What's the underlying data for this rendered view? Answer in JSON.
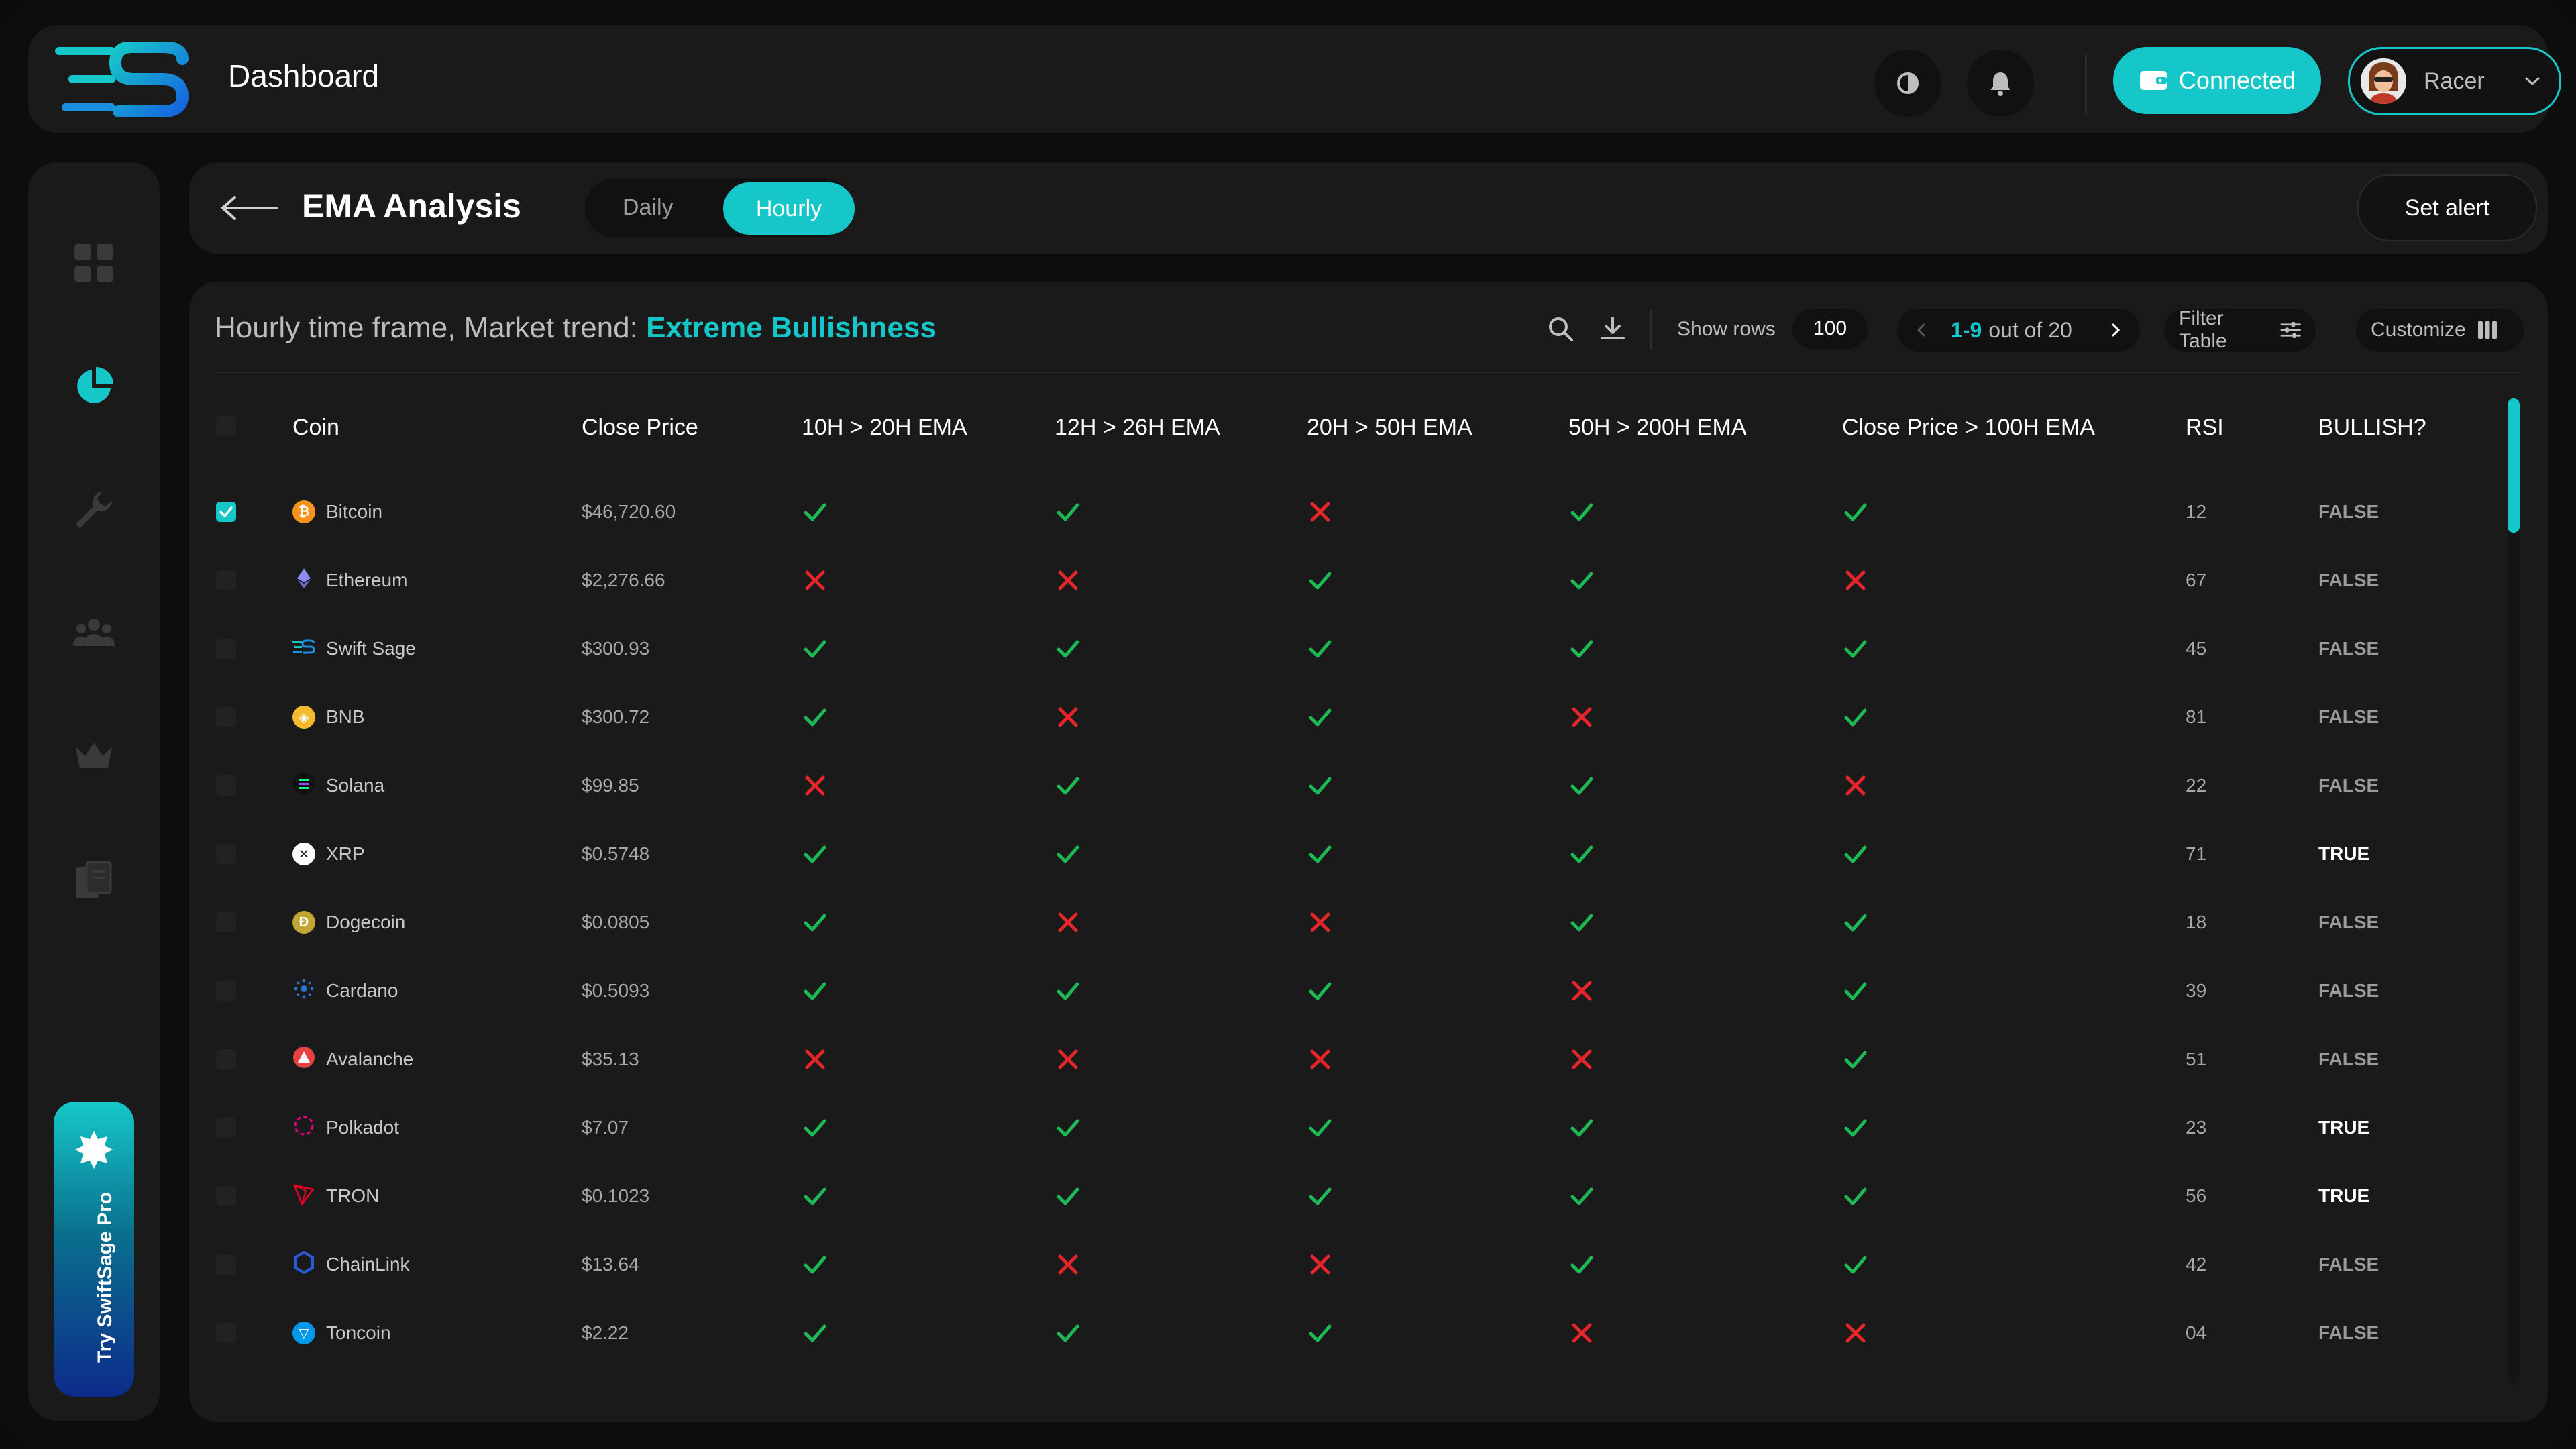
{
  "app": {
    "title": "Dashboard",
    "user_name": "Racer",
    "wallet_status": "Connected"
  },
  "header": {
    "title": "EMA Analysis",
    "tabs": [
      {
        "label": "Daily",
        "selected": false
      },
      {
        "label": "Hourly",
        "selected": true
      }
    ],
    "alert_label": "Set alert"
  },
  "toolbar": {
    "trend_prefix": "Hourly time frame, Market trend: ",
    "trend_value": "Extreme Bullishness",
    "show_rows_label": "Show rows",
    "show_rows_value": "100",
    "pager_range": "1-9",
    "pager_total": "out of 20",
    "filter_label": "Filter Table",
    "customize_label": "Customize"
  },
  "promo": {
    "label": "Try SwiftSage Pro"
  },
  "colors": {
    "accent": "#16c7c9",
    "check": "#1db954",
    "cross": "#e5252a"
  },
  "table": {
    "columns": [
      "Coin",
      "Close Price",
      "10H > 20H EMA",
      "12H > 26H EMA",
      "20H > 50H EMA",
      "50H > 200H EMA",
      "Close Price > 100H EMA",
      "RSI",
      "BULLISH?"
    ],
    "rows": [
      {
        "coin": "Bitcoin",
        "icon": "bitcoin-icon",
        "price": "$46,720.60",
        "ema": [
          true,
          true,
          false,
          true,
          true
        ],
        "rsi": "12",
        "bullish": "FALSE",
        "checked": true
      },
      {
        "coin": "Ethereum",
        "icon": "ethereum-icon",
        "price": "$2,276.66",
        "ema": [
          false,
          false,
          true,
          true,
          false
        ],
        "rsi": "67",
        "bullish": "FALSE",
        "checked": false
      },
      {
        "coin": "Swift Sage",
        "icon": "swift-sage-icon",
        "price": "$300.93",
        "ema": [
          true,
          true,
          true,
          true,
          true
        ],
        "rsi": "45",
        "bullish": "FALSE",
        "checked": false
      },
      {
        "coin": "BNB",
        "icon": "bnb-icon",
        "price": "$300.72",
        "ema": [
          true,
          false,
          true,
          false,
          true
        ],
        "rsi": "81",
        "bullish": "FALSE",
        "checked": false
      },
      {
        "coin": "Solana",
        "icon": "solana-icon",
        "price": "$99.85",
        "ema": [
          false,
          true,
          true,
          true,
          false
        ],
        "rsi": "22",
        "bullish": "FALSE",
        "checked": false
      },
      {
        "coin": "XRP",
        "icon": "xrp-icon",
        "price": "$0.5748",
        "ema": [
          true,
          true,
          true,
          true,
          true
        ],
        "rsi": "71",
        "bullish": "TRUE",
        "checked": false
      },
      {
        "coin": "Dogecoin",
        "icon": "dogecoin-icon",
        "price": "$0.0805",
        "ema": [
          true,
          false,
          false,
          true,
          true
        ],
        "rsi": "18",
        "bullish": "FALSE",
        "checked": false
      },
      {
        "coin": "Cardano",
        "icon": "cardano-icon",
        "price": "$0.5093",
        "ema": [
          true,
          true,
          true,
          false,
          true
        ],
        "rsi": "39",
        "bullish": "FALSE",
        "checked": false
      },
      {
        "coin": "Avalanche",
        "icon": "avalanche-icon",
        "price": "$35.13",
        "ema": [
          false,
          false,
          false,
          false,
          true
        ],
        "rsi": "51",
        "bullish": "FALSE",
        "checked": false
      },
      {
        "coin": "Polkadot",
        "icon": "polkadot-icon",
        "price": "$7.07",
        "ema": [
          true,
          true,
          true,
          true,
          true
        ],
        "rsi": "23",
        "bullish": "TRUE",
        "checked": false
      },
      {
        "coin": "TRON",
        "icon": "tron-icon",
        "price": "$0.1023",
        "ema": [
          true,
          true,
          true,
          true,
          true
        ],
        "rsi": "56",
        "bullish": "TRUE",
        "checked": false
      },
      {
        "coin": "ChainLink",
        "icon": "chainlink-icon",
        "price": "$13.64",
        "ema": [
          true,
          false,
          false,
          true,
          true
        ],
        "rsi": "42",
        "bullish": "FALSE",
        "checked": false
      },
      {
        "coin": "Toncoin",
        "icon": "toncoin-icon",
        "price": "$2.22",
        "ema": [
          true,
          true,
          true,
          false,
          false
        ],
        "rsi": "04",
        "bullish": "FALSE",
        "checked": false
      }
    ]
  }
}
